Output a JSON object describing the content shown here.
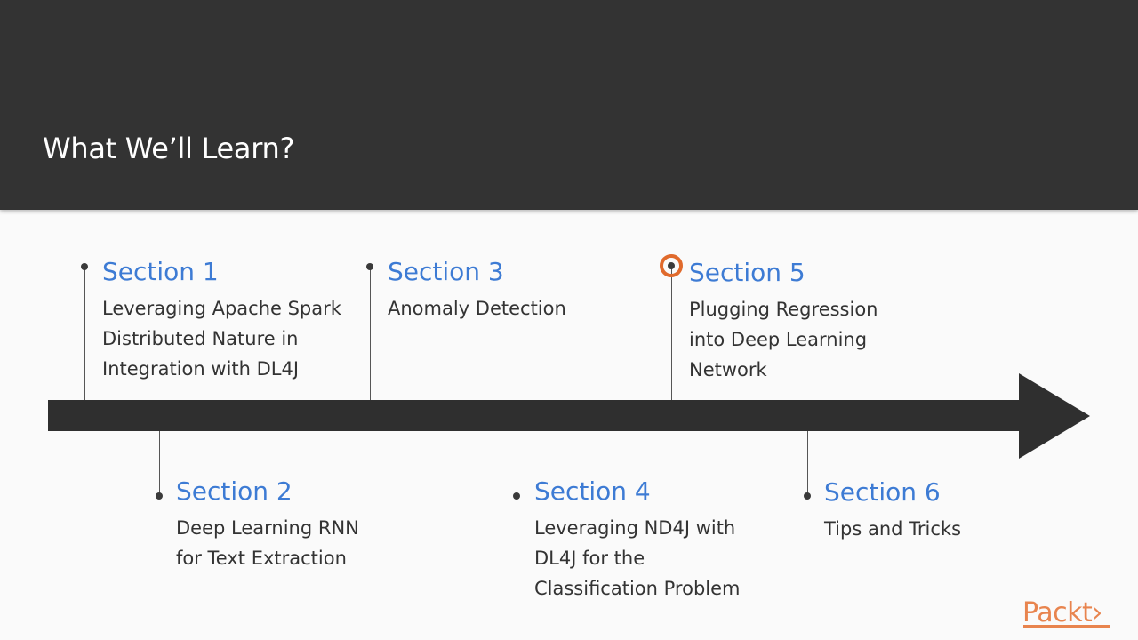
{
  "slide": {
    "title": "What We’ll Learn?"
  },
  "timeline": {
    "sections": [
      {
        "title": "Section 1",
        "description": "Leveraging Apache Spark\nDistributed Nature in\nIntegration with DL4J",
        "position": "above"
      },
      {
        "title": "Section 2",
        "description": "Deep Learning RNN\nfor Text Extraction",
        "position": "below"
      },
      {
        "title": "Section 3",
        "description": "Anomaly Detection",
        "position": "above"
      },
      {
        "title": "Section 4",
        "description": "Leveraging ND4J with\nDL4J for the\nClassification Problem",
        "position": "below"
      },
      {
        "title": "Section 5",
        "description": "Plugging Regression\ninto Deep Learning\nNetwork",
        "position": "above",
        "highlighted": true
      },
      {
        "title": "Section 6",
        "description": "Tips and Tricks",
        "position": "below"
      }
    ]
  },
  "colors": {
    "header_bg": "#333333",
    "section_title": "#3d7bd4",
    "highlight_ring": "#e06a2c",
    "brand": "#e8844e"
  },
  "brand": {
    "logo_text": "Packt›"
  }
}
